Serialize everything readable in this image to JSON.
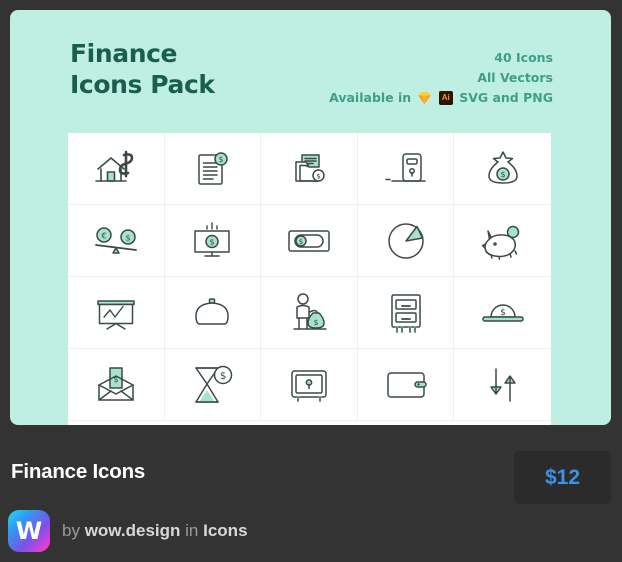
{
  "card": {
    "background_color": "#BFEFE2",
    "title_lines": [
      "Finance",
      "Icons Pack"
    ],
    "title_color": "#1A5E4E",
    "meta": {
      "count_label": "40 Icons",
      "vectors_label": "All Vectors",
      "available_prefix": "Available in",
      "formats_label": "SVG and PNG",
      "app_badges": [
        {
          "name": "sketch-icon",
          "label": "Sketch",
          "color": "#FDB32B"
        },
        {
          "name": "illustrator-icon",
          "label": "Ai",
          "bg": "#2B1306",
          "fg": "#FF9A00"
        }
      ],
      "text_color": "#3E9E86"
    }
  },
  "grid": {
    "columns": 5,
    "rows": 4,
    "sheet_color": "#FFFFFF",
    "line_color": "#F0F0F0",
    "stroke_color": "#3C4A45",
    "accent_color": "#A6E3CF",
    "icons": [
      {
        "name": "house-dollar-icon",
        "label": "House with dollar sign"
      },
      {
        "name": "invoice-document-icon",
        "label": "Document with coin"
      },
      {
        "name": "folder-payment-icon",
        "label": "Folder with coin"
      },
      {
        "name": "atm-machine-icon",
        "label": "ATM machine"
      },
      {
        "name": "money-bag-icon",
        "label": "Money bag with dollar coin"
      },
      {
        "name": "currency-balance-scale-icon",
        "label": "Balance scale with euro and dollar coins"
      },
      {
        "name": "monitor-dollar-icon",
        "label": "Monitor with dollar coin"
      },
      {
        "name": "banknote-icon",
        "label": "Banknote with dollar coin"
      },
      {
        "name": "pie-chart-icon",
        "label": "Pie chart"
      },
      {
        "name": "piggy-bank-icon",
        "label": "Piggy bank with coin"
      },
      {
        "name": "presentation-chart-icon",
        "label": "Presentation board with line chart"
      },
      {
        "name": "coin-purse-icon",
        "label": "Coin purse"
      },
      {
        "name": "person-money-bag-icon",
        "label": "Person holding money bag"
      },
      {
        "name": "filing-cabinet-icon",
        "label": "Filing cabinet"
      },
      {
        "name": "coin-deposit-slot-icon",
        "label": "Coin in deposit slot"
      },
      {
        "name": "envelope-money-icon",
        "label": "Envelope with dollar bill"
      },
      {
        "name": "hourglass-money-icon",
        "label": "Hourglass with dollar coin"
      },
      {
        "name": "safe-box-icon",
        "label": "Safe box"
      },
      {
        "name": "wallet-icon",
        "label": "Wallet"
      },
      {
        "name": "transfer-arrows-icon",
        "label": "Up and down transfer arrows"
      }
    ]
  },
  "info": {
    "item_title": "Finance Icons",
    "price": "$12",
    "price_color": "#3B92E8",
    "author": {
      "logo_letter": "W",
      "by_label": "by",
      "author_name": "wow.design",
      "in_label": "in",
      "category": "Icons"
    }
  }
}
